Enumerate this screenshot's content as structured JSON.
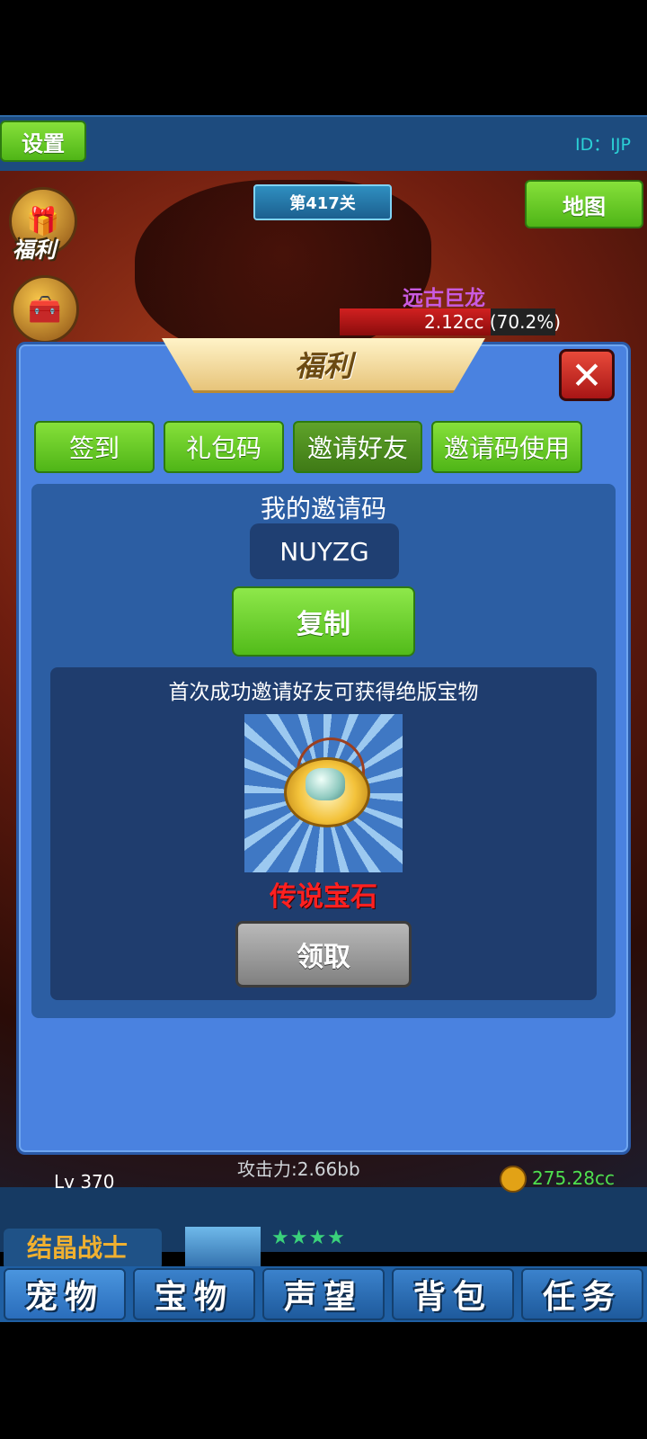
{
  "topbar": {
    "settings_label": "设置",
    "user_id": "ID：IJP"
  },
  "scene": {
    "stage": "第417关",
    "map_label": "地图",
    "welfare_label": "福利",
    "boss": {
      "name": "远古巨龙",
      "hp_text": "2.12cc (70.2%)",
      "hp_fraction": 0.702
    }
  },
  "modal": {
    "title": "福利",
    "close_icon": "close-icon",
    "tabs": [
      {
        "label": "签到"
      },
      {
        "label": "礼包码"
      },
      {
        "label": "邀请好友",
        "active": true
      },
      {
        "label": "邀请码使用"
      }
    ],
    "my_code_label": "我的邀请码",
    "invite_code": "NUYZG",
    "copy_label": "复制",
    "reward_desc": "首次成功邀请好友可获得绝版宝物",
    "reward_name": "传说宝石",
    "claim_label": "领取"
  },
  "background": {
    "level": "Lv 370",
    "attack": "攻击力:2.66bb",
    "coins": "275.28cc",
    "hero_name": "结晶战士",
    "hero_stars": "★★★★"
  },
  "tabbar": {
    "items": [
      {
        "label": "宠物"
      },
      {
        "label": "宝物"
      },
      {
        "label": "声望"
      },
      {
        "label": "背包"
      },
      {
        "label": "任务"
      }
    ]
  },
  "colors": {
    "modal_bg": "#4a82e0",
    "accent_green": "#5fc21f",
    "reward_red": "#ff2020"
  }
}
